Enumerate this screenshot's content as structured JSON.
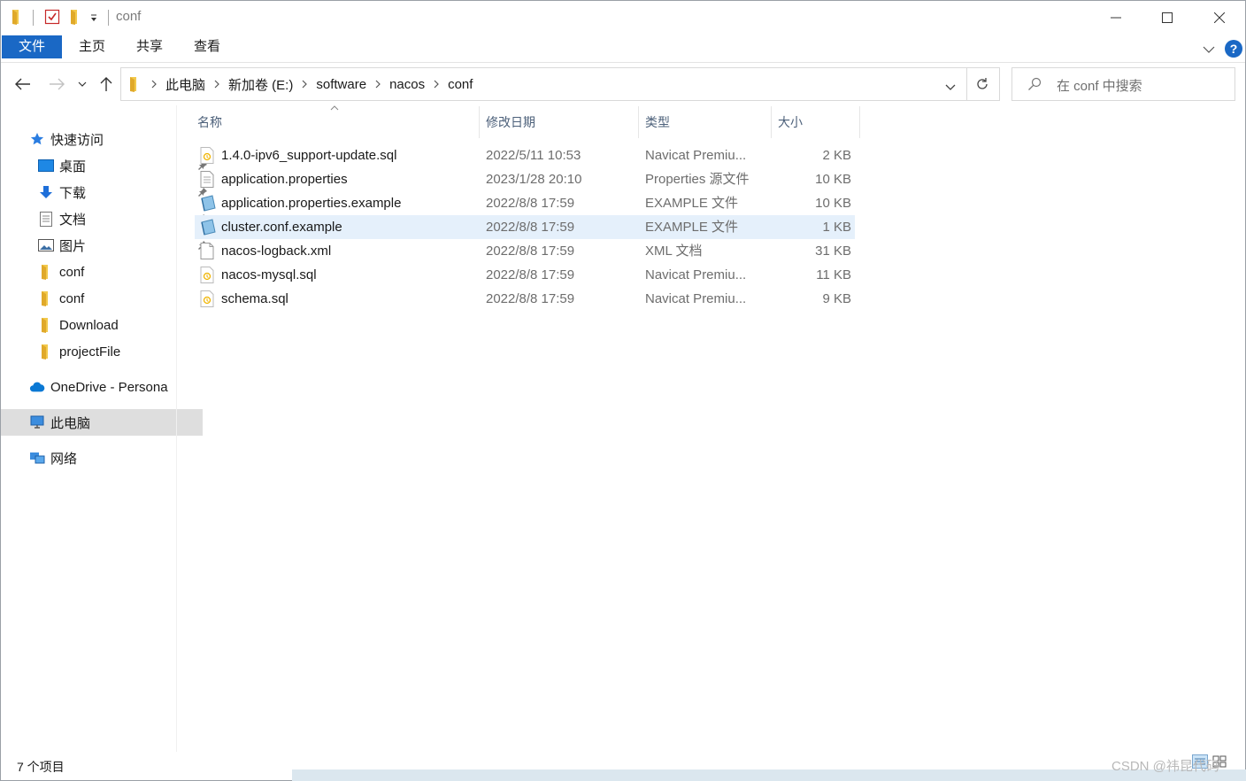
{
  "window": {
    "title": "conf"
  },
  "ribbon": {
    "tabs": [
      "文件",
      "主页",
      "共享",
      "查看"
    ],
    "help": "?"
  },
  "address": {
    "crumbs": [
      "此电脑",
      "新加卷 (E:)",
      "software",
      "nacos",
      "conf"
    ],
    "search_placeholder": "在 conf 中搜索"
  },
  "sidebar": {
    "items": [
      {
        "label": "快速访问",
        "icon": "star-icon"
      },
      {
        "label": "桌面",
        "icon": "desktop-icon",
        "pinned": true
      },
      {
        "label": "下载",
        "icon": "download-icon",
        "pinned": true
      },
      {
        "label": "文档",
        "icon": "document-icon",
        "pinned": true
      },
      {
        "label": "图片",
        "icon": "picture-icon",
        "pinned": true
      },
      {
        "label": "conf",
        "icon": "folder-icon"
      },
      {
        "label": "conf",
        "icon": "folder-icon"
      },
      {
        "label": "Download",
        "icon": "folder-icon"
      },
      {
        "label": "projectFile",
        "icon": "folder-icon"
      },
      {
        "label": "OneDrive - Persona",
        "icon": "cloud-icon"
      },
      {
        "label": "此电脑",
        "icon": "computer-icon",
        "selected": true
      },
      {
        "label": "网络",
        "icon": "network-icon"
      }
    ]
  },
  "columns": {
    "name": "名称",
    "date": "修改日期",
    "type": "类型",
    "size": "大小"
  },
  "files": [
    {
      "name": "1.4.0-ipv6_support-update.sql",
      "date": "2022/5/11 10:53",
      "type": "Navicat Premiu...",
      "size": "2 KB",
      "icon": "sql-file-icon"
    },
    {
      "name": "application.properties",
      "date": "2023/1/28 20:10",
      "type": "Properties 源文件",
      "size": "10 KB",
      "icon": "text-file-icon"
    },
    {
      "name": "application.properties.example",
      "date": "2022/8/8 17:59",
      "type": "EXAMPLE 文件",
      "size": "10 KB",
      "icon": "example-file-icon"
    },
    {
      "name": "cluster.conf.example",
      "date": "2022/8/8 17:59",
      "type": "EXAMPLE 文件",
      "size": "1 KB",
      "icon": "example-file-icon",
      "highlighted": true
    },
    {
      "name": "nacos-logback.xml",
      "date": "2022/8/8 17:59",
      "type": "XML 文档",
      "size": "31 KB",
      "icon": "blank-file-icon"
    },
    {
      "name": "nacos-mysql.sql",
      "date": "2022/8/8 17:59",
      "type": "Navicat Premiu...",
      "size": "11 KB",
      "icon": "sql-file-icon"
    },
    {
      "name": "schema.sql",
      "date": "2022/8/8 17:59",
      "type": "Navicat Premiu...",
      "size": "9 KB",
      "icon": "sql-file-icon"
    }
  ],
  "status": {
    "count": "7 个项目"
  },
  "watermark": "CSDN @祎昆代码",
  "colors": {
    "accent": "#1a68c5",
    "folder": "#f2c94c",
    "highlight": "#e5f0fb",
    "selected": "#dedede"
  }
}
